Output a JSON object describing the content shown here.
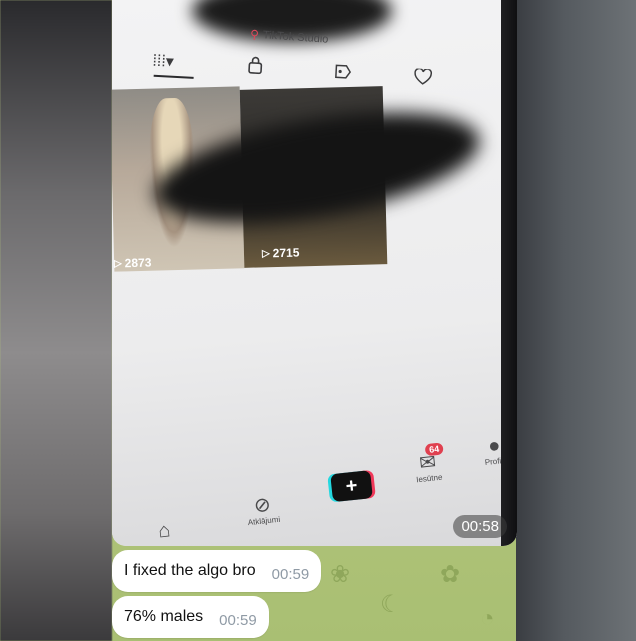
{
  "photo": {
    "studio_label": "TikTok Studio",
    "tabs": [
      {
        "icon": "grid-icon",
        "glyph": "⁞⁞⁞▾"
      },
      {
        "icon": "lock-icon",
        "glyph": "🔒"
      },
      {
        "icon": "tag-icon",
        "glyph": "🏷"
      },
      {
        "icon": "liked-icon",
        "glyph": "♡"
      }
    ],
    "videos": [
      {
        "views": "2873"
      },
      {
        "views": "2715"
      }
    ],
    "bottom_nav": {
      "home_label": "",
      "explore_label": "Atklājumi",
      "inbox_label": "Iesūtne",
      "inbox_badge": "64",
      "profile_label": "Profils"
    },
    "duration": "00:58"
  },
  "messages": [
    {
      "text": "I fixed the algo bro",
      "time": "00:59"
    },
    {
      "text": "76% males",
      "time": "00:59"
    }
  ],
  "colors": {
    "wallpaper": "#b8c97f",
    "bubble": "#ffffff",
    "time_text": "#8f9aa5",
    "badge": "#e0404f"
  }
}
